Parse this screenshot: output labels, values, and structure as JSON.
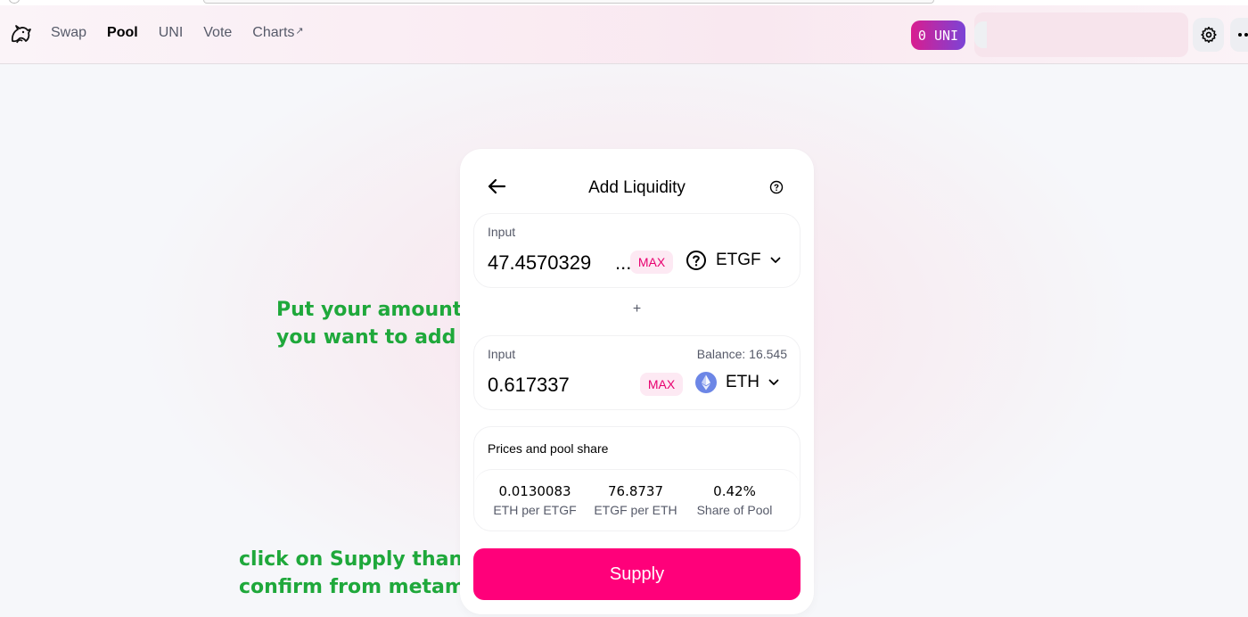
{
  "nav": {
    "items": [
      {
        "label": "Swap",
        "active": false
      },
      {
        "label": "Pool",
        "active": true
      },
      {
        "label": "UNI",
        "active": false
      },
      {
        "label": "Vote",
        "active": false
      },
      {
        "label": "Charts",
        "active": false,
        "external_mark": "↗"
      }
    ]
  },
  "header": {
    "uni_badge": "0 UNI",
    "settings_icon": "gear-icon",
    "more_icon": "more-icon",
    "logo_icon": "unicorn-logo-icon"
  },
  "card": {
    "title": "Add Liquidity",
    "input1": {
      "label": "Input",
      "amount": "47.4570329",
      "overflow": "...",
      "max_label": "MAX",
      "token": "ETGF",
      "token_icon": "question-icon"
    },
    "plus": "+",
    "input2": {
      "label": "Input",
      "balance": "Balance: 16.545",
      "amount": "0.617337",
      "max_label": "MAX",
      "token": "ETH",
      "token_icon": "ethereum-icon"
    },
    "prices": {
      "title": "Prices and pool share",
      "stats": [
        {
          "value": "0.0130083",
          "label": "ETH per ETGF"
        },
        {
          "value": "76.8737",
          "label": "ETGF per ETH"
        },
        {
          "value": "0.42%",
          "label": "Share of Pool"
        }
      ]
    },
    "supply_label": "Supply"
  },
  "annotations": {
    "note1_line1": "Put your amount",
    "note1_line2": "you want to add",
    "note2_line1": "click on Supply than",
    "note2_line2": "confirm from metamask"
  },
  "colors": {
    "accent": "#ff007a",
    "annotation": "#1fa83b",
    "uni_gradient_start": "#d91d8f",
    "uni_gradient_end": "#7b43d6"
  }
}
